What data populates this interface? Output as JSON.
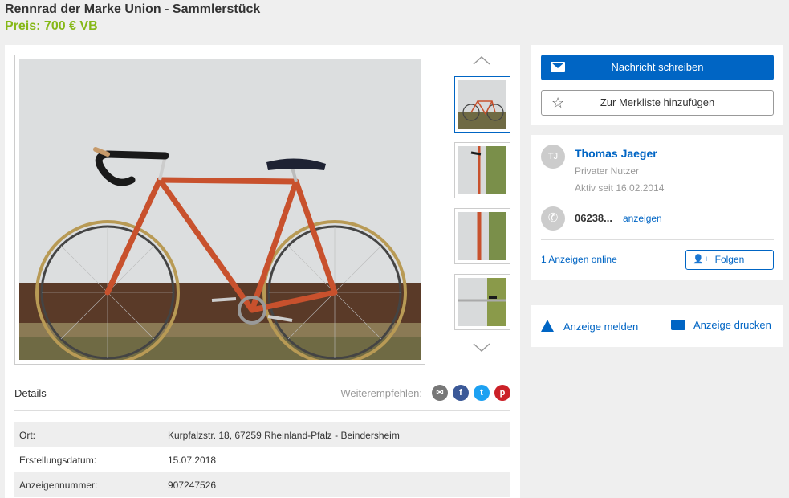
{
  "listing": {
    "title": "Rennrad der Marke Union - Sammlerstück",
    "price": "Preis: 700 € VB"
  },
  "details": {
    "label": "Details",
    "share_label": "Weiterempfehlen:",
    "rows": [
      {
        "key": "Ort:",
        "value": "Kurpfalzstr. 18, 67259 Rheinland-Pfalz - Beindersheim"
      },
      {
        "key": "Erstellungsdatum:",
        "value": "15.07.2018"
      },
      {
        "key": "Anzeigennummer:",
        "value": "907247526"
      }
    ]
  },
  "actions": {
    "message": "Nachricht schreiben",
    "watchlist": "Zur Merkliste hinzufügen"
  },
  "seller": {
    "initials": "TJ",
    "name": "Thomas Jaeger",
    "type": "Privater Nutzer",
    "active_since": "Aktiv seit 16.02.2014",
    "phone": "06238...",
    "phone_show": "anzeigen",
    "ads_online": "1 Anzeigen online",
    "follow": "Folgen"
  },
  "misc": {
    "report": "Anzeige melden",
    "print": "Anzeige drucken"
  },
  "icons": {
    "share_email": "email-icon",
    "share_facebook": "facebook-icon",
    "share_twitter": "twitter-icon",
    "share_pinterest": "pinterest-icon"
  },
  "colors": {
    "accent": "#0065c4",
    "price": "#86b817"
  }
}
